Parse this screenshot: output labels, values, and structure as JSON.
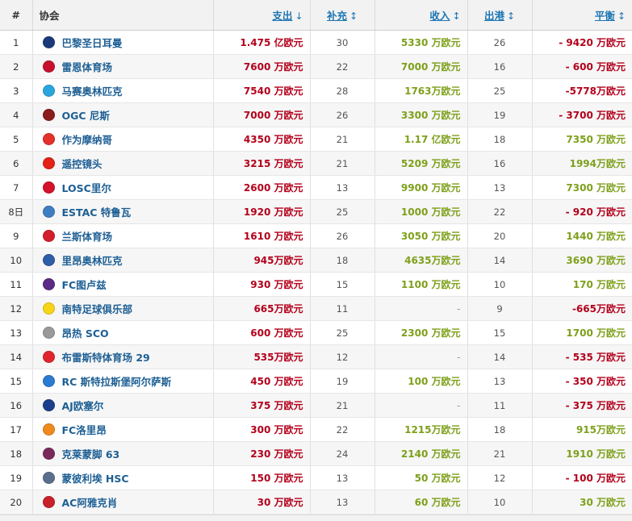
{
  "headers": {
    "rank": "#",
    "club": "协会",
    "spend": "支出",
    "arrivals": "补充",
    "income": "收入",
    "departures": "出港",
    "balance": "平衡"
  },
  "colors": {
    "club_link": "#1d5f94",
    "spend": "#b3001b",
    "income": "#7ea01b",
    "balance_negative": "#b3001b",
    "balance_positive": "#7ea01b"
  },
  "rows": [
    {
      "rank": "1",
      "club": "巴黎圣日耳曼",
      "crest_color": "#1b3a7a",
      "spend": "1.475 亿欧元",
      "arrivals": "30",
      "income": "5330 万欧元",
      "departures": "26",
      "balance": "- 9420 万欧元",
      "balance_sign": "neg"
    },
    {
      "rank": "2",
      "club": "雷恩体育场",
      "crest_color": "#c8102e",
      "spend": "7600 万欧元",
      "arrivals": "22",
      "income": "7000 万欧元",
      "departures": "16",
      "balance": "- 600 万欧元",
      "balance_sign": "neg"
    },
    {
      "rank": "3",
      "club": "马赛奥林匹克",
      "crest_color": "#2aa6de",
      "spend": "7540 万欧元",
      "arrivals": "28",
      "income": "1763万欧元",
      "departures": "25",
      "balance": "-5778万欧元",
      "balance_sign": "neg"
    },
    {
      "rank": "4",
      "club": "OGC 尼斯",
      "crest_color": "#8a1c1c",
      "spend": "7000 万欧元",
      "arrivals": "26",
      "income": "3300 万欧元",
      "departures": "19",
      "balance": "- 3700 万欧元",
      "balance_sign": "neg"
    },
    {
      "rank": "5",
      "club": "作为摩纳哥",
      "crest_color": "#e4312b",
      "spend": "4350 万欧元",
      "arrivals": "21",
      "income": "1.17 亿欧元",
      "departures": "18",
      "balance": "7350 万欧元",
      "balance_sign": "pos"
    },
    {
      "rank": "6",
      "club": "遥控镜头",
      "crest_color": "#e32219",
      "spend": "3215 万欧元",
      "arrivals": "21",
      "income": "5209 万欧元",
      "departures": "16",
      "balance": "1994万欧元",
      "balance_sign": "pos"
    },
    {
      "rank": "7",
      "club": "LOSC里尔",
      "crest_color": "#d4122a",
      "spend": "2600 万欧元",
      "arrivals": "13",
      "income": "9900 万欧元",
      "departures": "13",
      "balance": "7300 万欧元",
      "balance_sign": "pos"
    },
    {
      "rank": "8日",
      "club": "ESTAC 特鲁瓦",
      "crest_color": "#3f7fc1",
      "spend": "1920 万欧元",
      "arrivals": "25",
      "income": "1000 万欧元",
      "departures": "22",
      "balance": "- 920 万欧元",
      "balance_sign": "neg"
    },
    {
      "rank": "9",
      "club": "兰斯体育场",
      "crest_color": "#d21f2b",
      "spend": "1610 万欧元",
      "arrivals": "26",
      "income": "3050 万欧元",
      "departures": "20",
      "balance": "1440 万欧元",
      "balance_sign": "pos"
    },
    {
      "rank": "10",
      "club": "里昂奥林匹克",
      "crest_color": "#2f5ea8",
      "spend": "945万欧元",
      "arrivals": "18",
      "income": "4635万欧元",
      "departures": "14",
      "balance": "3690 万欧元",
      "balance_sign": "pos"
    },
    {
      "rank": "11",
      "club": "FC图卢兹",
      "crest_color": "#5b2a86",
      "spend": "930 万欧元",
      "arrivals": "15",
      "income": "1100 万欧元",
      "departures": "10",
      "balance": "170 万欧元",
      "balance_sign": "pos"
    },
    {
      "rank": "12",
      "club": "南特足球俱乐部",
      "crest_color": "#f7d417",
      "spend": "665万欧元",
      "arrivals": "11",
      "income": "-",
      "departures": "9",
      "balance": "-665万欧元",
      "balance_sign": "neg"
    },
    {
      "rank": "13",
      "club": "昂热 SCO",
      "crest_color": "#9a9a9a",
      "spend": "600 万欧元",
      "arrivals": "25",
      "income": "2300 万欧元",
      "departures": "15",
      "balance": "1700 万欧元",
      "balance_sign": "pos"
    },
    {
      "rank": "14",
      "club": "布雷斯特体育场 29",
      "crest_color": "#e0262d",
      "spend": "535万欧元",
      "arrivals": "12",
      "income": "-",
      "departures": "14",
      "balance": "- 535 万欧元",
      "balance_sign": "neg"
    },
    {
      "rank": "15",
      "club": "RC 斯特拉斯堡阿尔萨斯",
      "crest_color": "#2b7bd0",
      "spend": "450 万欧元",
      "arrivals": "19",
      "income": "100 万欧元",
      "departures": "13",
      "balance": "- 350 万欧元",
      "balance_sign": "neg"
    },
    {
      "rank": "16",
      "club": "AJ欧塞尔",
      "crest_color": "#1c3f8c",
      "spend": "375 万欧元",
      "arrivals": "21",
      "income": "-",
      "departures": "11",
      "balance": "- 375 万欧元",
      "balance_sign": "neg"
    },
    {
      "rank": "17",
      "club": "FC洛里昂",
      "crest_color": "#f08a1c",
      "spend": "300 万欧元",
      "arrivals": "22",
      "income": "1215万欧元",
      "departures": "18",
      "balance": "915万欧元",
      "balance_sign": "pos"
    },
    {
      "rank": "18",
      "club": "克莱蒙脚 63",
      "crest_color": "#7a2a5a",
      "spend": "230 万欧元",
      "arrivals": "24",
      "income": "2140 万欧元",
      "departures": "21",
      "balance": "1910 万欧元",
      "balance_sign": "pos"
    },
    {
      "rank": "19",
      "club": "蒙彼利埃 HSC",
      "crest_color": "#5a6f8c",
      "spend": "150 万欧元",
      "arrivals": "13",
      "income": "50 万欧元",
      "departures": "12",
      "balance": "- 100 万欧元",
      "balance_sign": "neg"
    },
    {
      "rank": "20",
      "club": "AC阿雅克肖",
      "crest_color": "#c9202b",
      "spend": "30 万欧元",
      "arrivals": "13",
      "income": "60 万欧元",
      "departures": "10",
      "balance": "30 万欧元",
      "balance_sign": "pos"
    }
  ]
}
